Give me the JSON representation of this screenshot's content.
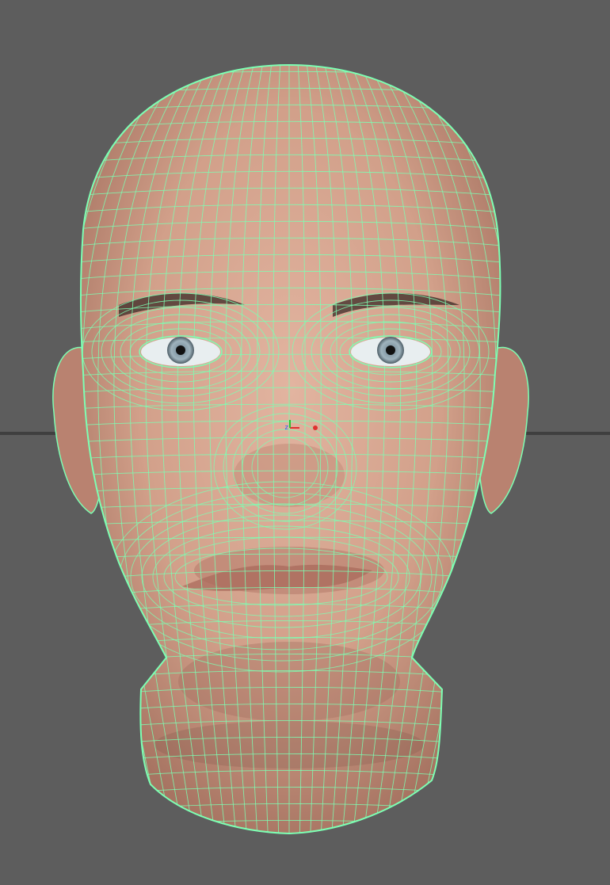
{
  "viewport": {
    "background": "#5d5d5d",
    "grid_line_color": "#3f3f3f",
    "view": "front"
  },
  "model": {
    "type": "head-mesh",
    "display": "textured-with-wireframe",
    "skin_color": "#d6a590",
    "skin_shadow": "#b98270",
    "wire_color": "#7dffb3",
    "iris_color": "#8fa6b3",
    "selected": true
  },
  "gizmo": {
    "axis_labels": {
      "z": "z"
    },
    "colors": {
      "x": "#e03030",
      "y": "#30c030",
      "z": "#3060ff"
    },
    "icon": "axis-gizmo-icon"
  }
}
